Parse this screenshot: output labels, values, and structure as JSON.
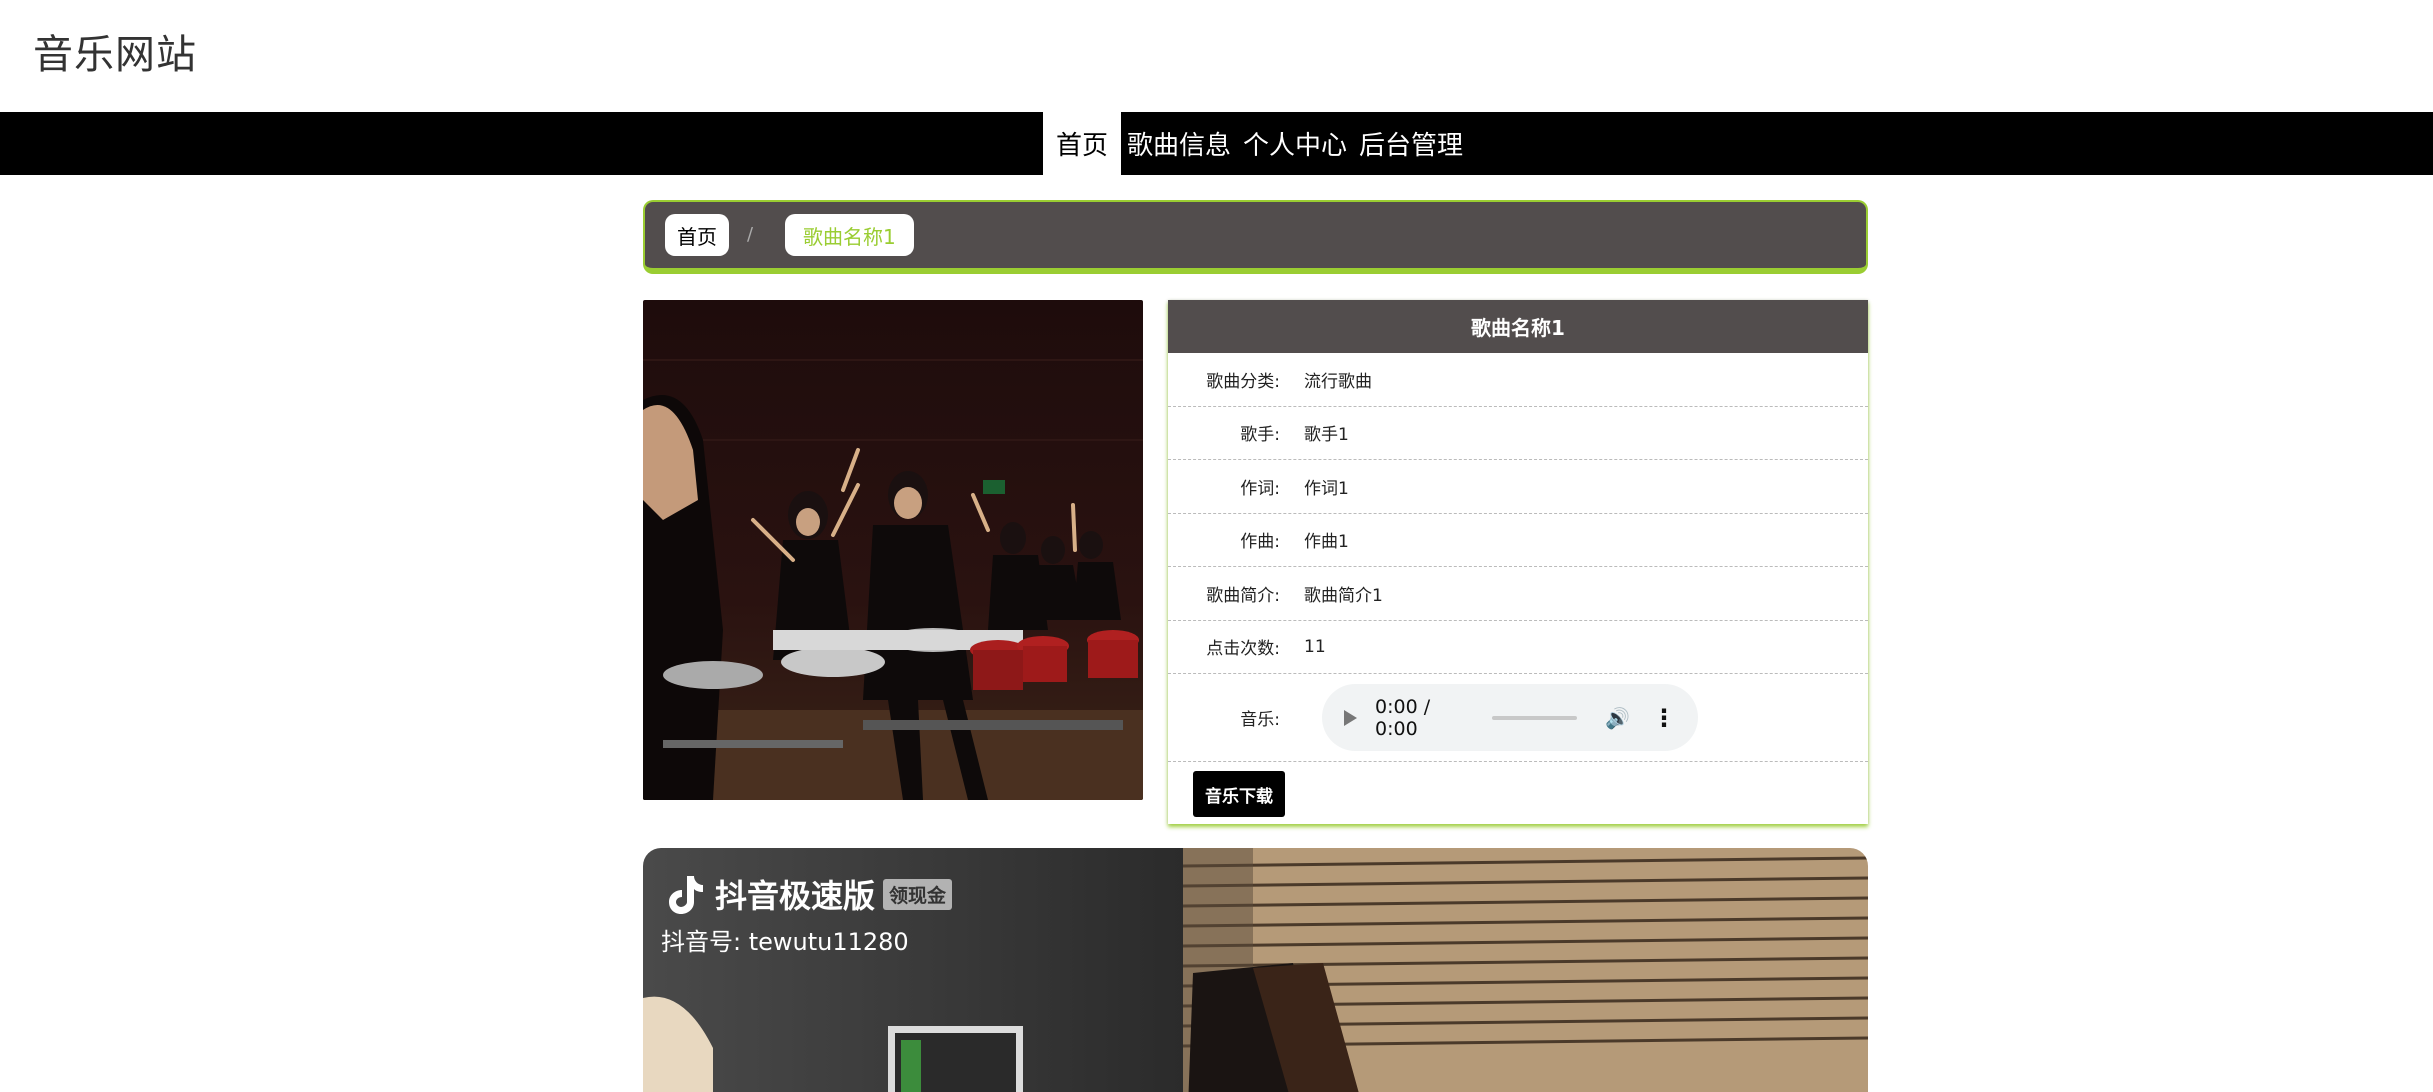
{
  "site": {
    "title": "音乐网站"
  },
  "nav": {
    "items": [
      {
        "label": "首页"
      },
      {
        "label": "歌曲信息"
      },
      {
        "label": "个人中心"
      },
      {
        "label": "后台管理"
      }
    ]
  },
  "breadcrumb": {
    "home": "首页",
    "separator": "/",
    "current": "歌曲名称1"
  },
  "song": {
    "title": "歌曲名称1",
    "fields": [
      {
        "label": "歌曲分类:",
        "value": "流行歌曲"
      },
      {
        "label": "歌手:",
        "value": "歌手1"
      },
      {
        "label": "作词:",
        "value": "作词1"
      },
      {
        "label": "作曲:",
        "value": "作曲1"
      },
      {
        "label": "歌曲简介:",
        "value": "歌曲简介1"
      },
      {
        "label": "点击次数:",
        "value": "11"
      }
    ],
    "music_label": "音乐:",
    "player_time": "0:00 / 0:00",
    "download_label": "音乐下载"
  },
  "video": {
    "app_name": "抖音极速版",
    "badge": "领现金",
    "account": "抖音号: tewutu11280"
  },
  "colors": {
    "accent": "#9acd32",
    "header_bg": "#524d4d",
    "nav_bg": "#000000"
  }
}
